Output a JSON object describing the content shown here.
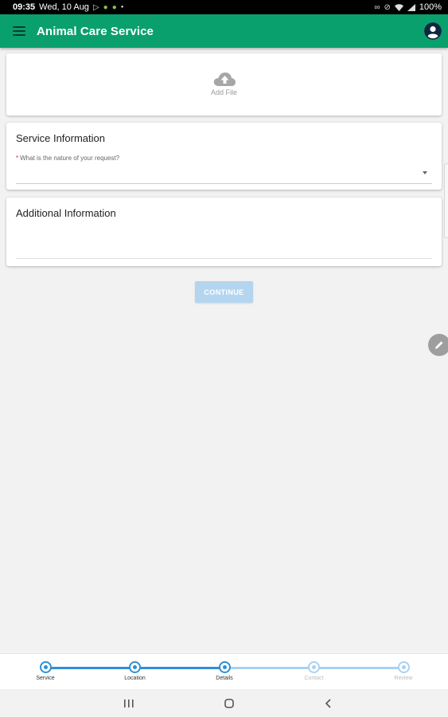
{
  "status_bar": {
    "time": "09:35",
    "date": "Wed, 10 Aug",
    "battery": "100%",
    "left_icons": [
      "media-icon",
      "android-icon",
      "android-icon",
      "dot-icon"
    ],
    "right_icons": [
      "link-icon",
      "mute-icon",
      "wifi-icon",
      "signal-icon"
    ]
  },
  "app_bar": {
    "title": "Animal Care Service",
    "color": "#0aa06e"
  },
  "upload": {
    "label": "Add File",
    "icon": "cloud-upload-icon"
  },
  "service_info": {
    "title": "Service Information",
    "required_mark": "*",
    "field_label": "What is the nature of your request?",
    "value": ""
  },
  "additional_info": {
    "title": "Additional Information",
    "value": ""
  },
  "continue_label": "CONTINUE",
  "stepper": {
    "active_color": "#2f8fd6",
    "inactive_color": "#a9d2f2",
    "steps": [
      {
        "label": "Service",
        "done": true
      },
      {
        "label": "Location",
        "done": true
      },
      {
        "label": "Details",
        "done": true
      },
      {
        "label": "Contact",
        "done": false
      },
      {
        "label": "Review",
        "done": false
      }
    ]
  },
  "nav_bar": [
    "recents-icon",
    "home-icon",
    "back-icon"
  ]
}
